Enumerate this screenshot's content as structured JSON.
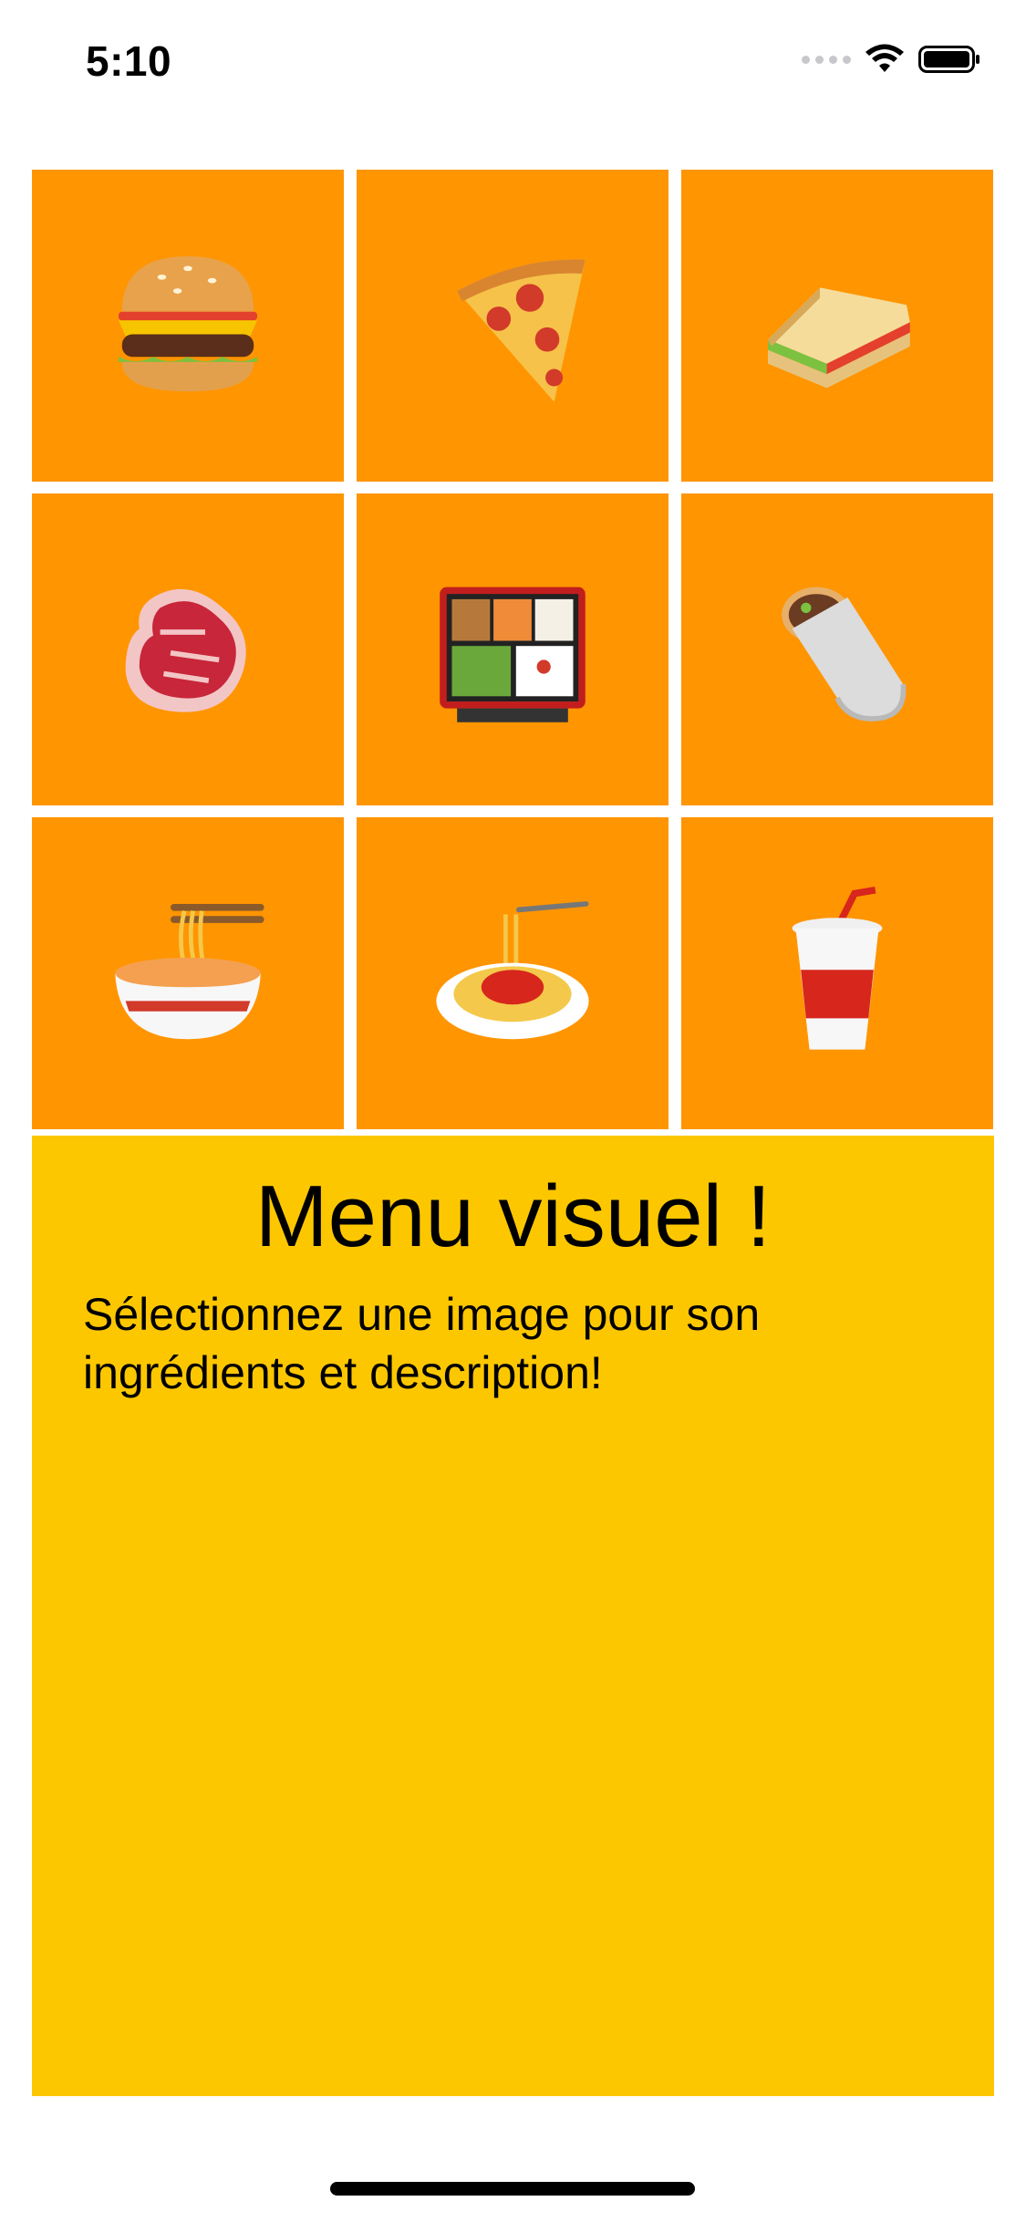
{
  "status_bar": {
    "time": "5:10",
    "icons": [
      "cellular-signal-icon",
      "wifi-icon",
      "battery-icon"
    ]
  },
  "grid": {
    "tile_color": "#ff9500",
    "items": [
      {
        "icon": "hamburger-icon"
      },
      {
        "icon": "pizza-slice-icon"
      },
      {
        "icon": "sandwich-icon"
      },
      {
        "icon": "steak-icon"
      },
      {
        "icon": "bento-box-icon"
      },
      {
        "icon": "burrito-icon"
      },
      {
        "icon": "noodle-bowl-icon"
      },
      {
        "icon": "spaghetti-icon"
      },
      {
        "icon": "soft-drink-cup-icon"
      }
    ]
  },
  "info_panel": {
    "background": "#fdc700",
    "title": "Menu visuel !",
    "description": "Sélectionnez une image pour son ingrédients et description!"
  }
}
